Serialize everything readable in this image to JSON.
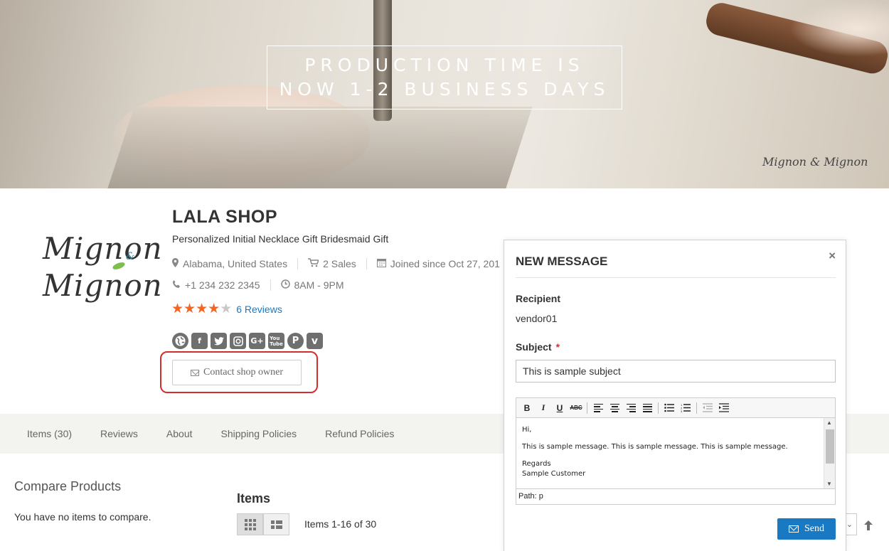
{
  "banner": {
    "line1": "PRODUCTION TIME IS",
    "line2": "NOW 1-2 BUSINESS DAYS",
    "signature": "Mignon & Mignon"
  },
  "logo": {
    "word1": "Mignon",
    "word2": "Mignon",
    "amp": "&"
  },
  "shop": {
    "name": "LALA SHOP",
    "tagline": "Personalized Initial Necklace Gift Bridesmaid Gift",
    "location": "Alabama, United States",
    "sales": "2 Sales",
    "joined": "Joined since Oct 27, 201",
    "phone": "+1 234 232 2345",
    "hours": "8AM - 9PM",
    "rating": 4,
    "rating_max": 5,
    "reviews": "6 Reviews",
    "contact_label": "Contact shop owner",
    "socials": [
      "globe-icon",
      "facebook-icon",
      "twitter-icon",
      "instagram-icon",
      "google-plus-icon",
      "youtube-icon",
      "pinterest-icon",
      "vimeo-icon"
    ]
  },
  "tabs": [
    "Items (30)",
    "Reviews",
    "About",
    "Shipping Policies",
    "Refund Policies"
  ],
  "sidebar": {
    "compare_title": "Compare Products",
    "compare_empty": "You have no items to compare."
  },
  "items": {
    "title": "Items",
    "count": "Items 1-16 of 30"
  },
  "modal": {
    "title": "NEW MESSAGE",
    "close": "×",
    "recipient_label": "Recipient",
    "recipient_value": "vendor01",
    "subject_label": "Subject",
    "required_mark": "*",
    "subject_value": "This is sample subject",
    "body": {
      "greeting": "Hi,",
      "message": "This is sample message. This is sample message. This is sample message.",
      "regards": "Regards",
      "signature": "Sample Customer"
    },
    "path": "Path: p",
    "send_label": "Send"
  },
  "colors": {
    "accent": "#1979c3",
    "star": "#f26522",
    "highlight": "#d42d2d"
  }
}
